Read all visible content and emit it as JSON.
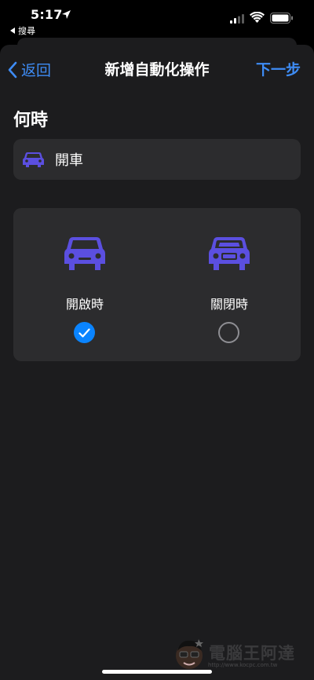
{
  "status_bar": {
    "time": "5:17",
    "back_app": "搜尋",
    "icons": [
      "location-arrow-icon",
      "signal-icon",
      "wifi-icon",
      "battery-icon"
    ]
  },
  "nav": {
    "back_label": "返回",
    "title": "新增自動化操作",
    "next_label": "下一步"
  },
  "section": {
    "title": "何時",
    "trigger": {
      "label": "開車",
      "icon": "car-icon"
    }
  },
  "options": [
    {
      "label": "開啟時",
      "icon": "car-icon",
      "selected": true
    },
    {
      "label": "關閉時",
      "icon": "car-outline-icon",
      "selected": false
    }
  ],
  "watermark": {
    "text": "電腦王阿達",
    "url": "http://www.kocpc.com.tw"
  },
  "colors": {
    "accent": "#3e8cf5",
    "car_icon": "#5b4fe0",
    "card_bg": "#2c2c2e",
    "sheet_bg": "#1c1c1e"
  }
}
